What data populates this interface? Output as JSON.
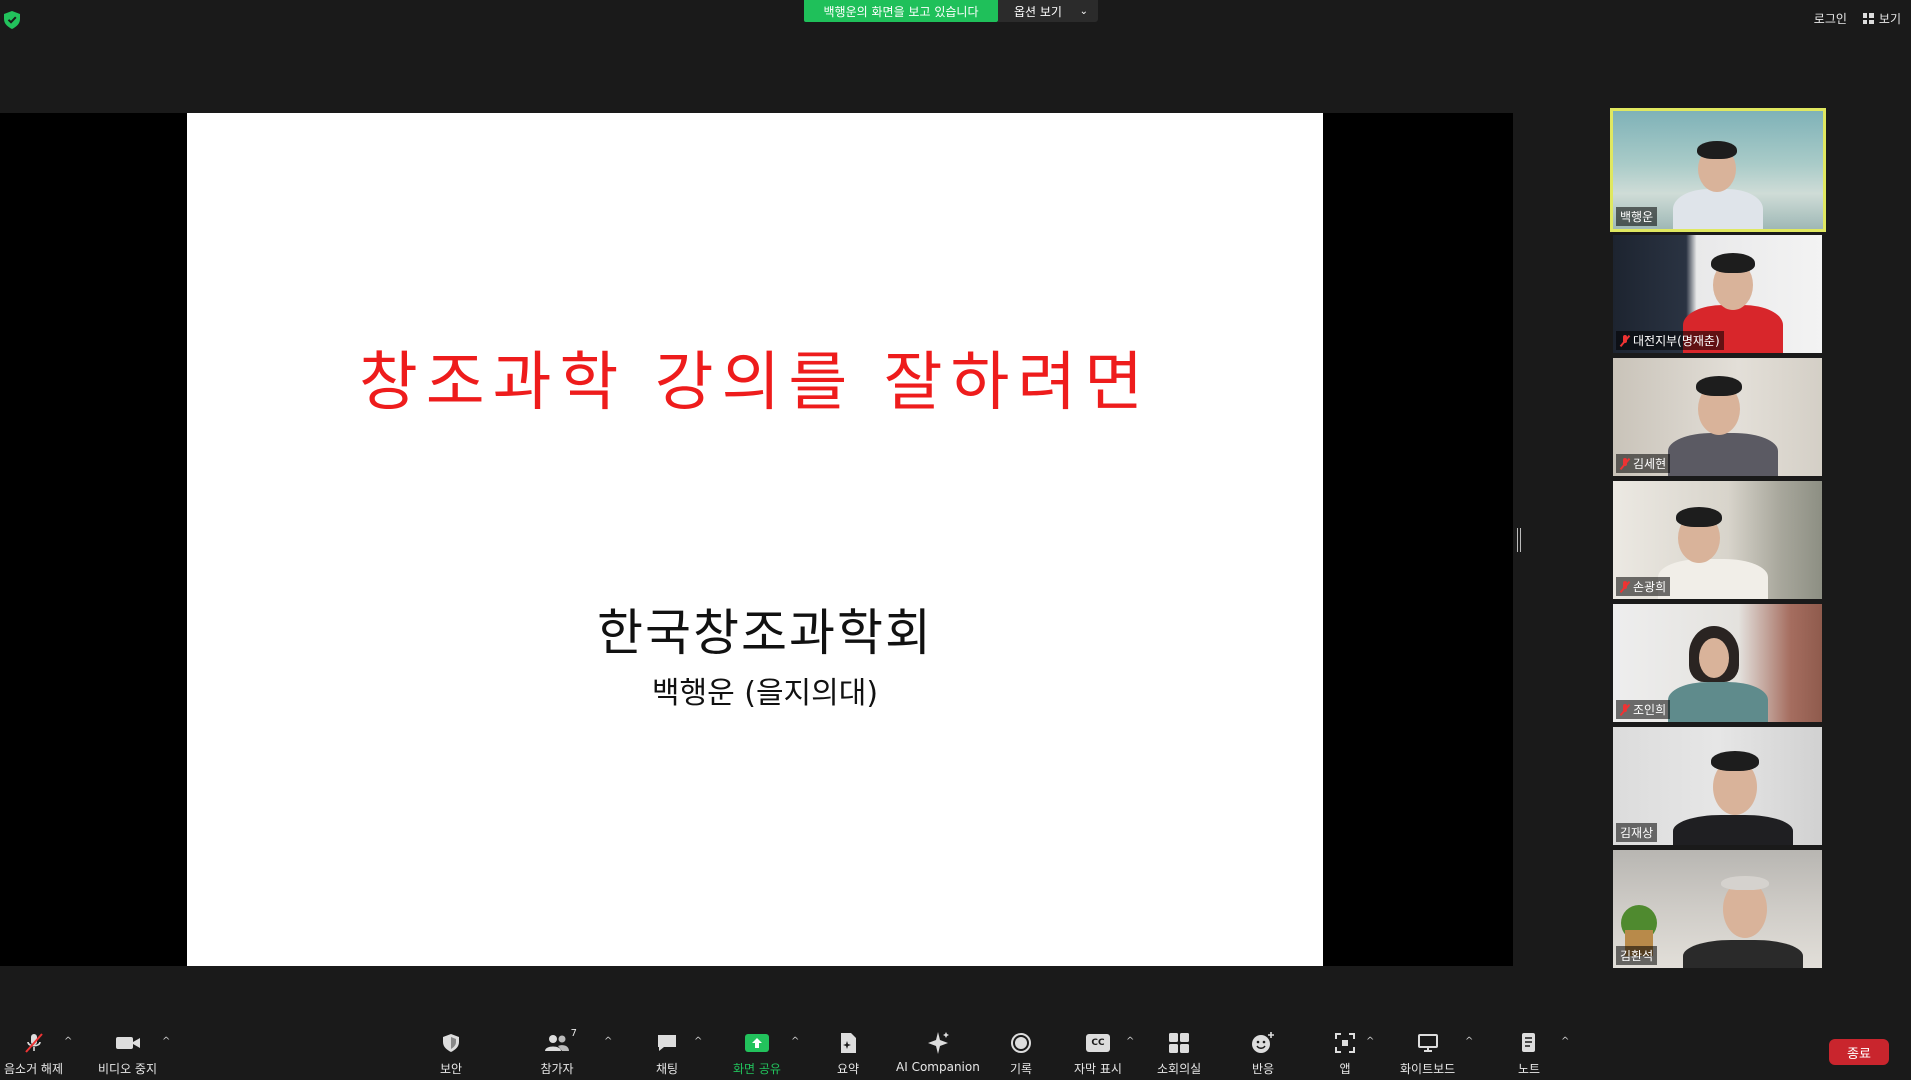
{
  "topbar": {
    "share_banner": "백행운의 화면을 보고 있습니다",
    "view_options": "옵션 보기",
    "login": "로그인",
    "view": "보기"
  },
  "slide": {
    "title": "창조과학 강의를 잘하려면",
    "organization": "한국창조과학회",
    "author": "백행운 (을지의대)"
  },
  "participants": [
    {
      "name": "백행운",
      "muted": false,
      "active": true
    },
    {
      "name": "대전지부(명재춘)",
      "muted": true,
      "active": false
    },
    {
      "name": "김세현",
      "muted": true,
      "active": false
    },
    {
      "name": "손광희",
      "muted": true,
      "active": false
    },
    {
      "name": "조인희",
      "muted": true,
      "active": false
    },
    {
      "name": "김재상",
      "muted": false,
      "active": false
    },
    {
      "name": "김환석",
      "muted": false,
      "active": false
    }
  ],
  "toolbar": {
    "unmute": "음소거 해제",
    "stop_video": "비디오 중지",
    "security": "보안",
    "participants": "참가자",
    "participants_count": "7",
    "chat": "채팅",
    "share_screen": "화면 공유",
    "summary": "요약",
    "ai_companion": "AI Companion",
    "record": "기록",
    "captions": "자막 표시",
    "breakout": "소회의실",
    "reactions": "반응",
    "apps": "앱",
    "whiteboard": "화이트보드",
    "notes": "노트",
    "end": "종료",
    "cc_badge": "CC"
  },
  "colors": {
    "share_green": "#1fc05a",
    "slide_title_red": "#ee1c1c",
    "end_red": "#c9252d",
    "active_speaker_border": "#e0e860"
  }
}
